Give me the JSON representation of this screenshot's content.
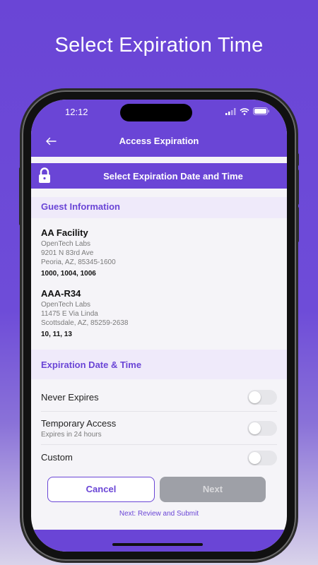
{
  "headline": "Select Expiration Time",
  "status": {
    "time": "12:12"
  },
  "appbar": {
    "title": "Access Expiration"
  },
  "banner": {
    "text": "Select Expiration Date and Time"
  },
  "guest_section": {
    "title": "Guest Information"
  },
  "sites": [
    {
      "name": "AA Facility",
      "company": "OpenTech Labs",
      "street": "9201 N 83rd Ave",
      "city": "Peoria, AZ, 85345-1600",
      "units": "1000, 1004, 1006"
    },
    {
      "name": "AAA-R34",
      "company": "OpenTech Labs",
      "street": "11475 E Via Linda",
      "city": "Scottsdale, AZ, 85259-2638",
      "units": "10, 11, 13"
    }
  ],
  "expiration_section": {
    "title": "Expiration Date & Time"
  },
  "options": [
    {
      "label": "Never Expires",
      "sub": "",
      "on": false
    },
    {
      "label": "Temporary Access",
      "sub": "Expires in 24 hours",
      "on": false
    },
    {
      "label": "Custom",
      "sub": "",
      "on": false
    }
  ],
  "actions": {
    "cancel": "Cancel",
    "next": "Next",
    "hint": "Next: Review and Submit"
  },
  "colors": {
    "accent": "#6a45d6",
    "disabled": "#9ea0a7"
  }
}
